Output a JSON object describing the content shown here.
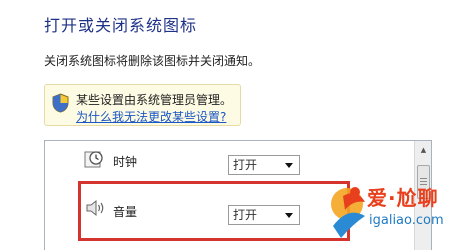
{
  "title": "打开或关闭系统图标",
  "description": "关闭系统图标将删除该图标并关闭通知。",
  "notice": {
    "icon": "shield-icon",
    "message": "某些设置由系统管理员管理。",
    "link": "为什么我无法更改某些设置?"
  },
  "rows": [
    {
      "icon": "clock-icon",
      "label": "时钟",
      "value": "打开"
    },
    {
      "icon": "volume-icon",
      "label": "音量",
      "value": "打开"
    }
  ],
  "watermark": {
    "line1": "爱·尬聊",
    "line2": "igaliao.com"
  },
  "colors": {
    "title": "#1e3287",
    "link": "#1a56c4",
    "highlight": "#d5332e",
    "notice_bg": "#fefbe4"
  }
}
